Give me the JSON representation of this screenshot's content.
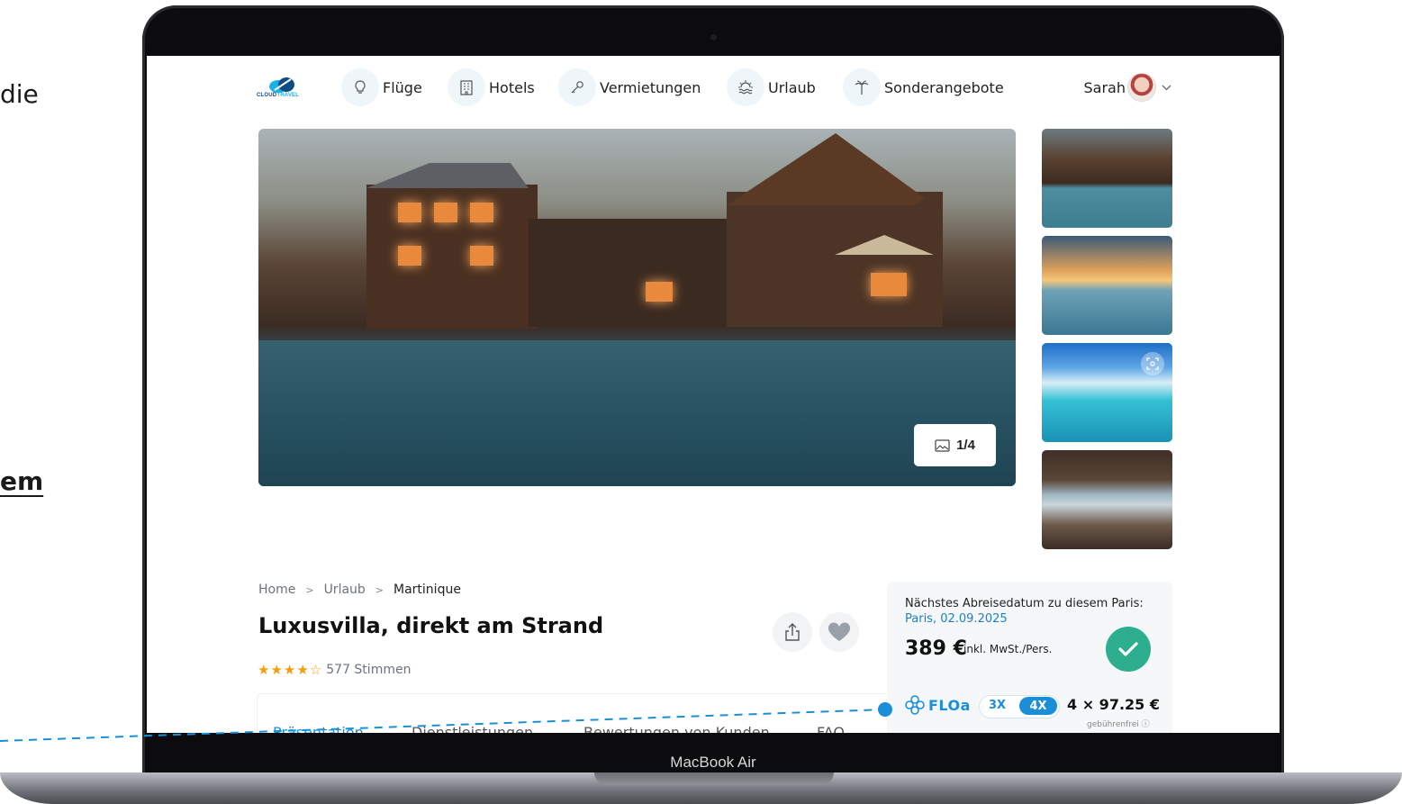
{
  "page": {
    "left_word_top": "die",
    "left_word_bottom": "em"
  },
  "device": {
    "label": "MacBook Air"
  },
  "nav": {
    "logo_text_a": "CLOUD",
    "logo_text_b": "TRAVEL",
    "items": [
      {
        "label": "Flüge",
        "icon": "lightbulb-icon"
      },
      {
        "label": "Hotels",
        "icon": "hotel-building-icon"
      },
      {
        "label": "Vermietungen",
        "icon": "key-icon"
      },
      {
        "label": "Urlaub",
        "icon": "sun-waves-icon"
      },
      {
        "label": "Sonderangebote",
        "icon": "palm-tree-icon"
      }
    ],
    "user_name": "Sarah"
  },
  "gallery": {
    "counter": "1/4",
    "thumbnails": [
      "lodge-pool",
      "sunset-sea",
      "tropical-island",
      "terrace-view"
    ]
  },
  "breadcrumb": {
    "items": [
      "Home",
      "Urlaub",
      "Martinique"
    ],
    "separator": ">"
  },
  "listing": {
    "title": "Luxusvilla, direkt am Strand",
    "stars_filled": 4,
    "stars_total": 5,
    "votes": "577 Stimmen"
  },
  "tabs": [
    "Präsentation",
    "Dienstleistungen",
    "Bewertungen von Kunden",
    "FAQ"
  ],
  "price_card": {
    "label": "Nächstes Abreisedatum zu diesem Paris:",
    "date": "Paris, 02.09.2025",
    "price": "389 €",
    "price_note": "inkl. MwSt./Pers.",
    "financing_brand": "FLOa",
    "option_3x": "3X",
    "option_4x": "4X",
    "installment": "4 × 97.25 €",
    "fee_note": "gebührenfrei ⓘ"
  },
  "colors": {
    "accent": "#1a8fd8",
    "success": "#2cae8f",
    "star": "#f59e0b",
    "pointer": "#1a8fd8"
  }
}
